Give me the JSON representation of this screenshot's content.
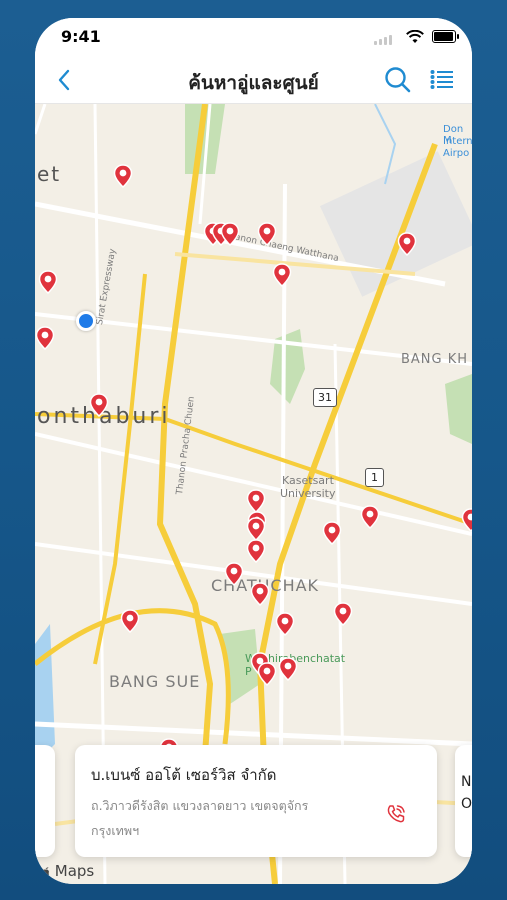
{
  "status": {
    "time": "9:41"
  },
  "nav": {
    "title": "ค้นหาอู่และศูนย์"
  },
  "map_labels": {
    "et": "et",
    "nonthaburi": "onthaburi",
    "bang_khen": "BANG KH",
    "chatuchak": "CHATUCHAK",
    "bang_sue": "BANG SUE",
    "kasetsart": "Kasetsart",
    "university": "University",
    "wachirabenchatat": "Wachirabenchatat",
    "park_fragment": "P",
    "don_mueang_1": "Don M",
    "don_mueang_2": "Intern",
    "don_mueang_3": "Airpo",
    "sirat": "Sirat Expressway",
    "chaeng": "Thanon Chaeng Watthana",
    "pracha": "Thanon Pracha Chuen",
    "route31": "31",
    "route1": "1"
  },
  "card": {
    "name": "บ.เบนซ์ ออโต้ เซอร์วิส จำกัด",
    "address": "ถ.วิภาวดีรังสิต แขวงลาดยาว เขตจตุจักร กรุงเทพฯ"
  },
  "right_card": {
    "line1": "NE",
    "line2": "Ol"
  },
  "maps_logo": "Maps",
  "colors": {
    "pin": "#e0333d",
    "accent": "#1f8bd1",
    "background": "#16578a"
  }
}
